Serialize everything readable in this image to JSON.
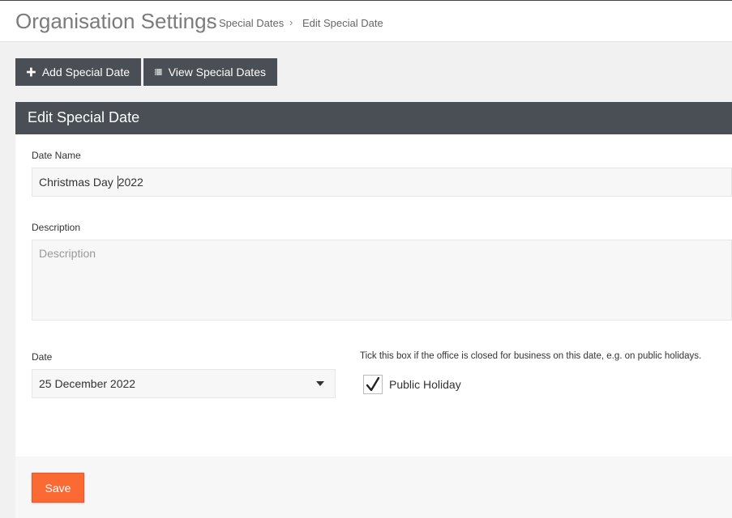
{
  "header": {
    "title": "Organisation Settings",
    "breadcrumbs": [
      {
        "label": "Special Dates"
      },
      {
        "label": "Edit Special Date"
      }
    ],
    "separator": "›"
  },
  "toolbar": {
    "add_label": "Add Special Date",
    "view_label": "View Special Dates"
  },
  "panel": {
    "title": "Edit Special Date"
  },
  "form": {
    "date_name": {
      "label": "Date Name",
      "value_before_caret": "Christmas Day ",
      "value_after_caret": "2022"
    },
    "description": {
      "label": "Description",
      "placeholder": "Description"
    },
    "date": {
      "label": "Date",
      "value": "25 December 2022"
    },
    "public_holiday": {
      "hint": "Tick this box if the office is closed for business on this date, e.g. on public holidays.",
      "label": "Public Holiday",
      "checked": true
    }
  },
  "actions": {
    "save_label": "Save"
  },
  "colors": {
    "dark_bar": "#4a4e55",
    "save_button": "#fc6a34"
  }
}
